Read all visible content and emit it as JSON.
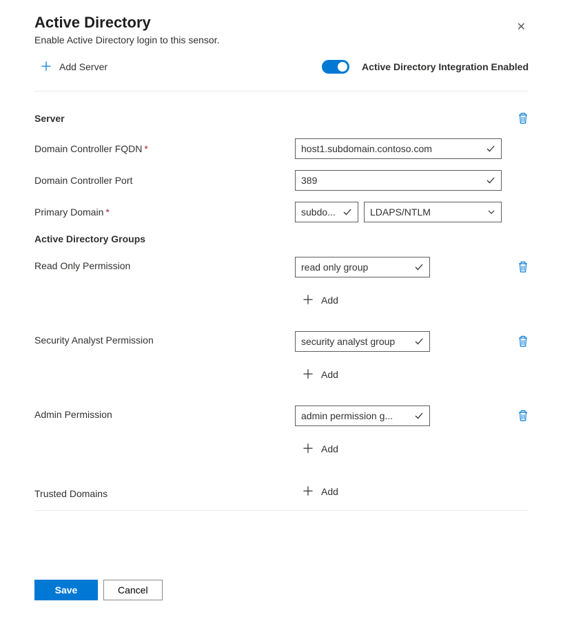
{
  "header": {
    "title": "Active Directory",
    "subtitle": "Enable Active Directory login to this sensor."
  },
  "actions": {
    "add_server": "Add Server",
    "toggle_label": "Active Directory Integration Enabled",
    "toggle_on": true
  },
  "server": {
    "heading": "Server",
    "fqdn_label": "Domain Controller FQDN",
    "fqdn_value": "host1.subdomain.contoso.com",
    "port_label": "Domain Controller Port",
    "port_value": "389",
    "primary_domain_label": "Primary Domain",
    "primary_domain_value": "subdo...",
    "auth_value": "LDAPS/NTLM"
  },
  "groups": {
    "heading": "Active Directory Groups",
    "read_only_label": "Read Only Permission",
    "read_only_value": "read only group",
    "analyst_label": "Security Analyst Permission",
    "analyst_value": "security analyst group",
    "admin_label": "Admin Permission",
    "admin_value": "admin permission g...",
    "trusted_label": "Trusted Domains",
    "add_label": "Add"
  },
  "footer": {
    "save": "Save",
    "cancel": "Cancel"
  }
}
